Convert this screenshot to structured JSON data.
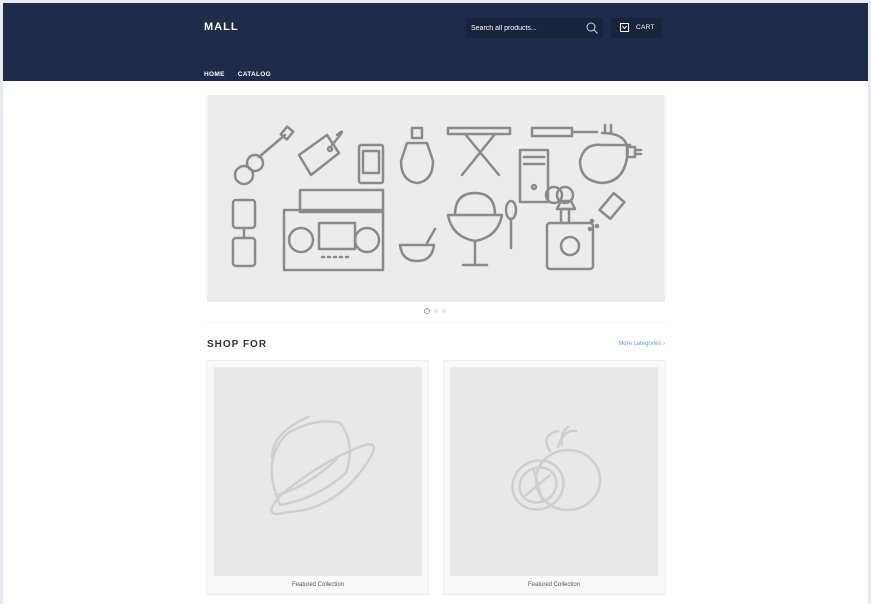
{
  "header": {
    "logo": "MALL",
    "search_placeholder": "Search all products...",
    "cart_label": "CART"
  },
  "nav": {
    "items": [
      {
        "label": "HOME"
      },
      {
        "label": "CATALOG"
      }
    ]
  },
  "slideshow": {
    "slide_count": 3,
    "active_index": 0
  },
  "shop_for": {
    "title": "SHOP FOR",
    "more_link": "More categories ›",
    "cards": [
      {
        "caption": "Featured Collection",
        "icon": "hat-icon"
      },
      {
        "caption": "Featured Collection",
        "icon": "orange-icon"
      }
    ]
  },
  "colors": {
    "header_bg": "#1c2c4a",
    "link_accent": "#6c9ed4",
    "placeholder_bg": "#e8e8e8"
  }
}
